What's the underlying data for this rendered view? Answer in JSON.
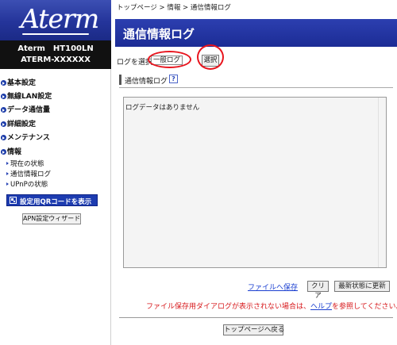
{
  "sidebar": {
    "logo_text": "Aterm",
    "model_line1": "Aterm　HT100LN",
    "model_line2": "ATERM-XXXXXX",
    "menu": [
      {
        "label": "基本設定"
      },
      {
        "label": "無線LAN設定"
      },
      {
        "label": "データ通信量"
      },
      {
        "label": "詳細設定"
      },
      {
        "label": "メンテナンス"
      },
      {
        "label": "情報"
      }
    ],
    "submenu": [
      {
        "label": "現在の状態"
      },
      {
        "label": "通信情報ログ"
      },
      {
        "label": "UPnPの状態"
      }
    ],
    "qr_button": "設定用QRコードを表示",
    "apn_button": "APN設定ウィザード"
  },
  "breadcrumb": "トップページ > 情報 > 通信情報ログ",
  "page_title": "通信情報ログ",
  "log_select": {
    "label": "ログを選択",
    "value": "一般ログ",
    "button": "選択"
  },
  "section": {
    "title": "通信情報ログ",
    "help": "?"
  },
  "log_area": {
    "text": "ログデータはありません"
  },
  "actions": {
    "save_link": "ファイルへ保存",
    "clear": "クリア",
    "refresh": "最新状態に更新"
  },
  "notice": {
    "before": "ファイル保存用ダイアログが表示されない場合は、",
    "link": "ヘルプ",
    "after": "を参照してください。"
  },
  "top_button": "トップページへ戻る",
  "colors": {
    "brand_blue": "#1c2c95",
    "highlight_red": "#e8141d",
    "link_blue": "#1a3fd0",
    "notice_red": "#d7191c"
  }
}
